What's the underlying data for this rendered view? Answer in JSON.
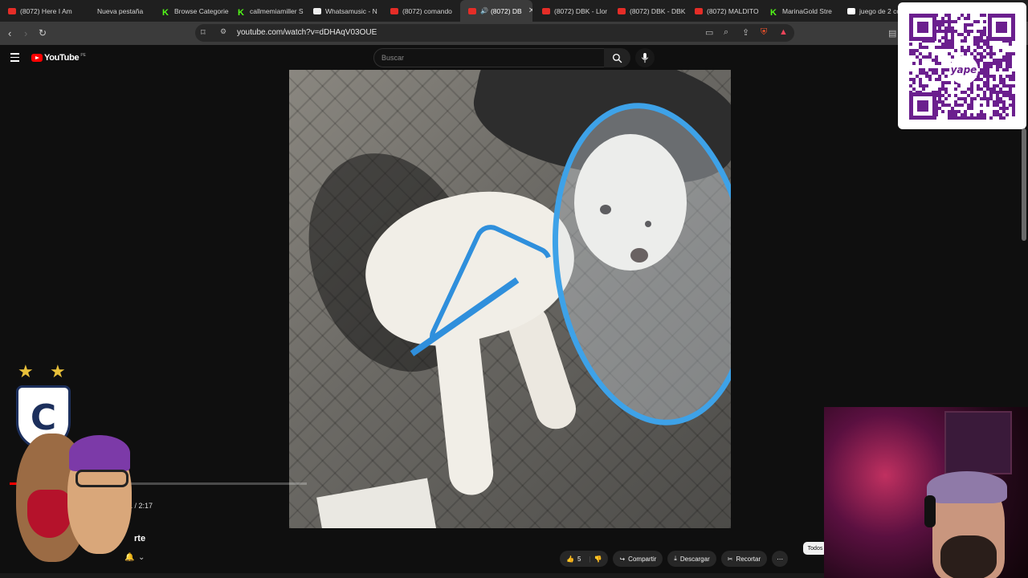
{
  "browser": {
    "tabs": [
      {
        "label": "(8072) Here I Am",
        "favicon": "youtube-icon"
      },
      {
        "label": "Nueva pestaña",
        "favicon": "none"
      },
      {
        "label": "Browse Categorie",
        "favicon": "kick-icon"
      },
      {
        "label": "callmemiamiller S",
        "favicon": "kick-icon"
      },
      {
        "label": "Whatsamusic - N",
        "favicon": "whatsamusic-icon"
      },
      {
        "label": "(8072) comando",
        "favicon": "youtube-icon"
      },
      {
        "label": "(8072) DB",
        "favicon": "youtube-icon",
        "active": true
      },
      {
        "label": "(8072) DBK - Llor",
        "favicon": "youtube-icon"
      },
      {
        "label": "(8072) DBK - DBK",
        "favicon": "youtube-icon"
      },
      {
        "label": "(8072) MALDITO",
        "favicon": "youtube-icon"
      },
      {
        "label": "MarinaGold Stre",
        "favicon": "kick-icon"
      },
      {
        "label": "juego de 2 co",
        "favicon": "google-icon"
      }
    ],
    "url": "youtube.com/watch?v=dDHAqV03OUE"
  },
  "youtube": {
    "logo_text": "YouTube",
    "country_code": "PE",
    "search_placeholder": "Buscar"
  },
  "player": {
    "progress_fraction": 0.05,
    "time": "1 / 2:17",
    "title_fragment": "rte"
  },
  "actions": {
    "like_count": "5",
    "share": "Compartir",
    "download": "Descargar",
    "clip": "Recortar",
    "chip_all": "Todos"
  },
  "overlay": {
    "qr_brand": "yape"
  },
  "colors": {
    "accent_red": "#ff0000",
    "yape_purple": "#6b1f8e",
    "cone_blue": "#3ea2e8"
  }
}
